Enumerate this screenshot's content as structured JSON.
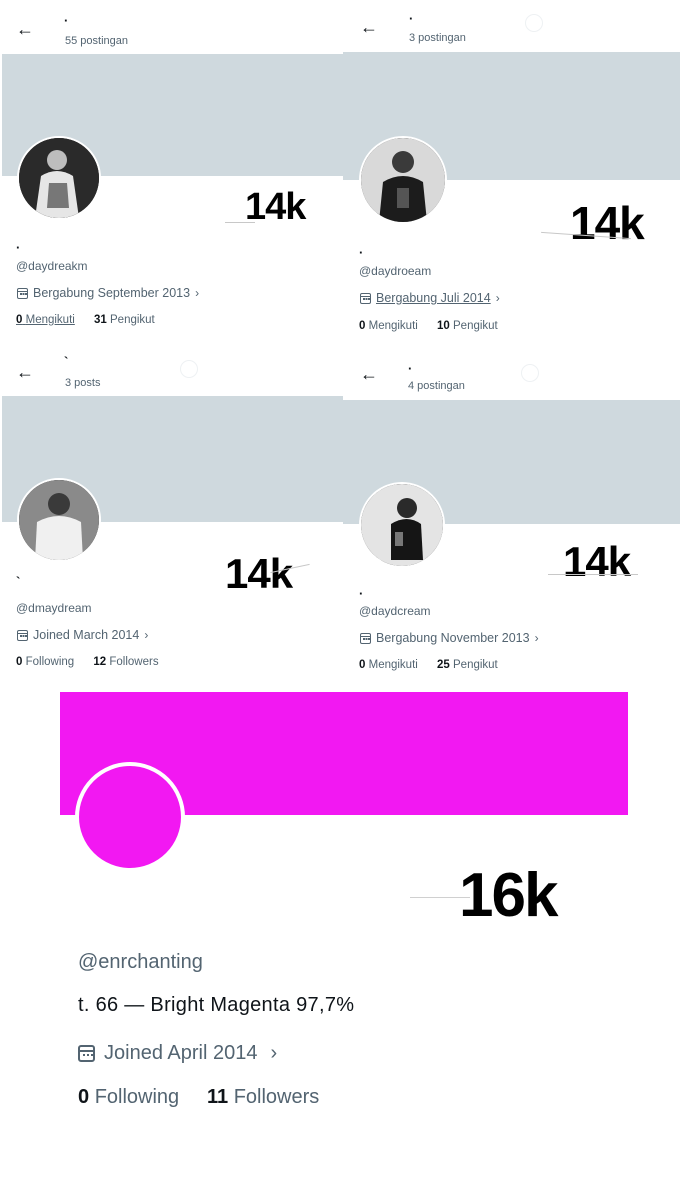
{
  "profiles": [
    {
      "name": "·",
      "post_count": "55 postingan",
      "handle": "@daydreakm",
      "joined": "Bergabung September 2013",
      "following_num": "0",
      "following_label": "Mengikuti",
      "followers_num": "31",
      "followers_label": "Pengikut",
      "overlay": "14k"
    },
    {
      "name": "·",
      "post_count": "3 postingan",
      "handle": "@daydroeam",
      "joined": "Bergabung Juli 2014",
      "following_num": "0",
      "following_label": "Mengikuti",
      "followers_num": "10",
      "followers_label": "Pengikut",
      "overlay": "14k"
    },
    {
      "name": "`",
      "post_count": "3 posts",
      "handle": "@dmaydream",
      "joined": "Joined March 2014",
      "following_num": "0",
      "following_label": "Following",
      "followers_num": "12",
      "followers_label": "Followers",
      "overlay": "14k"
    },
    {
      "name": "·",
      "post_count": "4 postingan",
      "handle": "@daydcream",
      "joined": "Bergabung November 2013",
      "following_num": "0",
      "following_label": "Mengikuti",
      "followers_num": "25",
      "followers_label": "Pengikut",
      "overlay": "14k"
    }
  ],
  "main_profile": {
    "overlay": "16k",
    "handle": "@enrchanting",
    "bio": "t. 66  —  Bright  Magenta  97,7%",
    "joined": "Joined April 2014",
    "following_num": "0",
    "following_label": "Following",
    "followers_num": "11",
    "followers_label": "Followers",
    "accent_color": "#f218f2"
  },
  "icons": {
    "back": "arrow-left-icon",
    "calendar": "calendar-icon",
    "chevron": "chevron-right-icon"
  },
  "colors": {
    "banner_gray": "#cfd9de",
    "text_secondary": "#536471"
  }
}
